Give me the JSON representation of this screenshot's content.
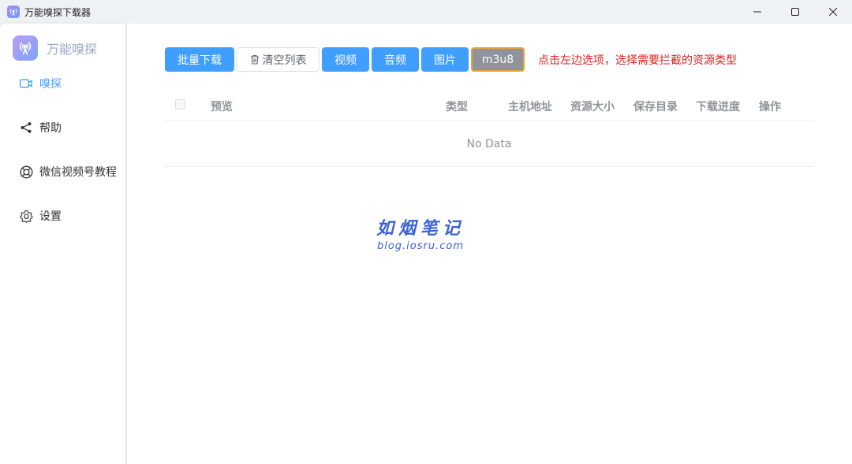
{
  "window": {
    "title": "万能嗅探下载器",
    "icons": {
      "app": "radar-app-icon",
      "minimize": "minimize-icon",
      "maximize": "maximize-icon",
      "close": "close-icon"
    }
  },
  "sidebar": {
    "brand": "万能嗅探",
    "items": [
      {
        "label": "嗅探",
        "icon": "video-camera-icon",
        "active": true
      },
      {
        "label": "帮助",
        "icon": "share-icon",
        "active": false
      },
      {
        "label": "微信视频号教程",
        "icon": "lifebuoy-icon",
        "active": false
      },
      {
        "label": "设置",
        "icon": "gear-icon",
        "active": false
      }
    ]
  },
  "toolbar": {
    "batch_download": "批量下载",
    "clear_list": "清空列表",
    "filters": [
      "视频",
      "音频",
      "图片",
      "m3u8"
    ],
    "hint": "点击左边选项，选择需要拦截的资源类型"
  },
  "table": {
    "columns": [
      "预览",
      "类型",
      "主机地址",
      "资源大小",
      "保存目录",
      "下载进度",
      "操作"
    ],
    "empty_text": "No Data"
  },
  "watermark": {
    "title": "如烟笔记",
    "subtitle": "blog.iosru.com"
  },
  "colors": {
    "primary": "#409eff",
    "hint": "#e02020",
    "selected_filter_bg": "#909399",
    "selected_filter_border": "#e6a23c",
    "watermark": "#3d62d6"
  }
}
